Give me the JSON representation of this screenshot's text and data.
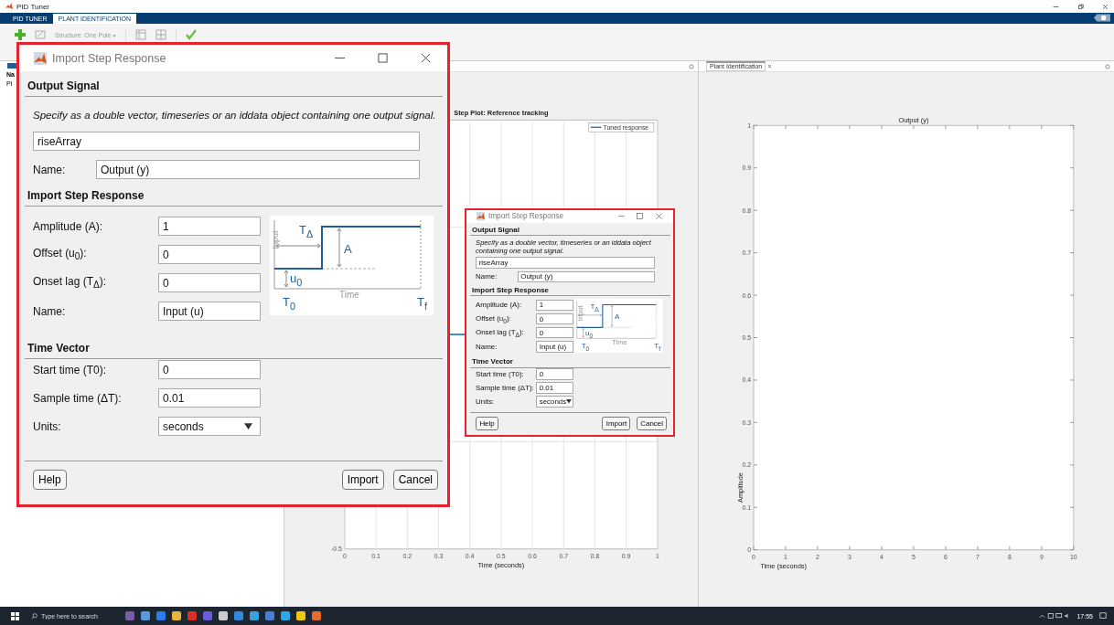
{
  "window": {
    "title": "PID Tuner"
  },
  "tabs": [
    {
      "label": "PID TUNER",
      "selected": false
    },
    {
      "label": "PLANT IDENTIFICATION",
      "selected": true
    }
  ],
  "toolstrip": {
    "structure": {
      "label": "Structure: One Pole",
      "disabled": true
    }
  },
  "data_browser": {
    "column": "Na",
    "row": "Pl"
  },
  "step_panel": {
    "title": "Step Plot: Reference tracking",
    "xlabel": "Time (seconds)",
    "x_tick_labels": [
      "0",
      "0.1",
      "0.2",
      "0.3",
      "0.4",
      "0.5",
      "0.6",
      "0.7",
      "0.8",
      "0.9",
      "1"
    ],
    "y_tick_label": "-0.5",
    "legend": "Tuned response"
  },
  "identification_panel": {
    "tab": "Plant Identification",
    "chart_data": {
      "type": "line",
      "title": "Output (y)",
      "xlabel": "Time (seconds)",
      "ylabel": "Amplitude",
      "xlim": [
        0,
        10
      ],
      "ylim": [
        0,
        1
      ],
      "xticks": [
        0,
        1,
        2,
        3,
        4,
        5,
        6,
        7,
        8,
        9,
        10
      ],
      "yticks": [
        0,
        0.1,
        0.2,
        0.3,
        0.4,
        0.5,
        0.6,
        0.7,
        0.8,
        0.9,
        1
      ]
    }
  },
  "dialogs": [
    {
      "title": "Import Step Response",
      "output_signal": {
        "heading": "Output Signal",
        "description": "Specify as a double vector, timeseries or an iddata object containing one output signal.",
        "variable": "riseArray",
        "name_label": "Name:",
        "name": "Output (y)"
      },
      "step_response": {
        "heading": "Import Step Response",
        "fields": [
          {
            "label": "Amplitude (A):",
            "value": "1"
          },
          {
            "label": "Offset (u$_{0}$):",
            "value": "0"
          },
          {
            "label": "Onset lag (T$_{Δ}$):",
            "value": "0"
          },
          {
            "label": "Name:",
            "value": "Input (u)"
          }
        ],
        "diagram": {
          "y_axis": "Input",
          "lag": "T$_{Δ}$",
          "amplitude": "A",
          "offset": "u$_{0}$",
          "x_axis": "Time",
          "start": "T$_{0}$",
          "end": "T$_{f}$"
        }
      },
      "time_vector": {
        "heading": "Time Vector",
        "fields": [
          {
            "label": "Start time (T0):",
            "value": "0",
            "kind": "text"
          },
          {
            "label": "Sample time (ΔT):",
            "value": "0.01",
            "kind": "text"
          },
          {
            "label": "Units:",
            "value": "seconds",
            "kind": "dropdown"
          }
        ]
      },
      "buttons": [
        "Help",
        "Import",
        "Cancel"
      ]
    },
    {
      "title": "Import Step Response",
      "output_signal": {
        "heading": "Output Signal",
        "description": "Specify as a double vector, timeseries or an iddata object containing one output signal.",
        "variable": "riseArray",
        "name_label": "Name:",
        "name": "Output (y)"
      },
      "step_response": {
        "heading": "Import Step Response",
        "fields": [
          {
            "label": "Amplitude (A):",
            "value": "1"
          },
          {
            "label": "Offset (u$_{0}$):",
            "value": "0"
          },
          {
            "label": "Onset lag (T$_{Δ}$):",
            "value": "0"
          },
          {
            "label": "Name:",
            "value": "Input (u)"
          }
        ],
        "diagram": {
          "y_axis": "Input",
          "lag": "T$_{Δ}$",
          "amplitude": "A",
          "offset": "u$_{0}$",
          "x_axis": "Time",
          "start": "T$_{0}$",
          "end": "T$_{f}$"
        }
      },
      "time_vector": {
        "heading": "Time Vector",
        "fields": [
          {
            "label": "Start time (T0):",
            "value": "0",
            "kind": "text"
          },
          {
            "label": "Sample time (ΔT):",
            "value": "0.01",
            "kind": "text"
          },
          {
            "label": "Units:",
            "value": "seconds",
            "kind": "dropdown"
          }
        ]
      },
      "buttons": [
        "Help",
        "Import",
        "Cancel"
      ]
    }
  ],
  "taskbar": {
    "search_placeholder": "Type here to search",
    "time": "17:55"
  }
}
